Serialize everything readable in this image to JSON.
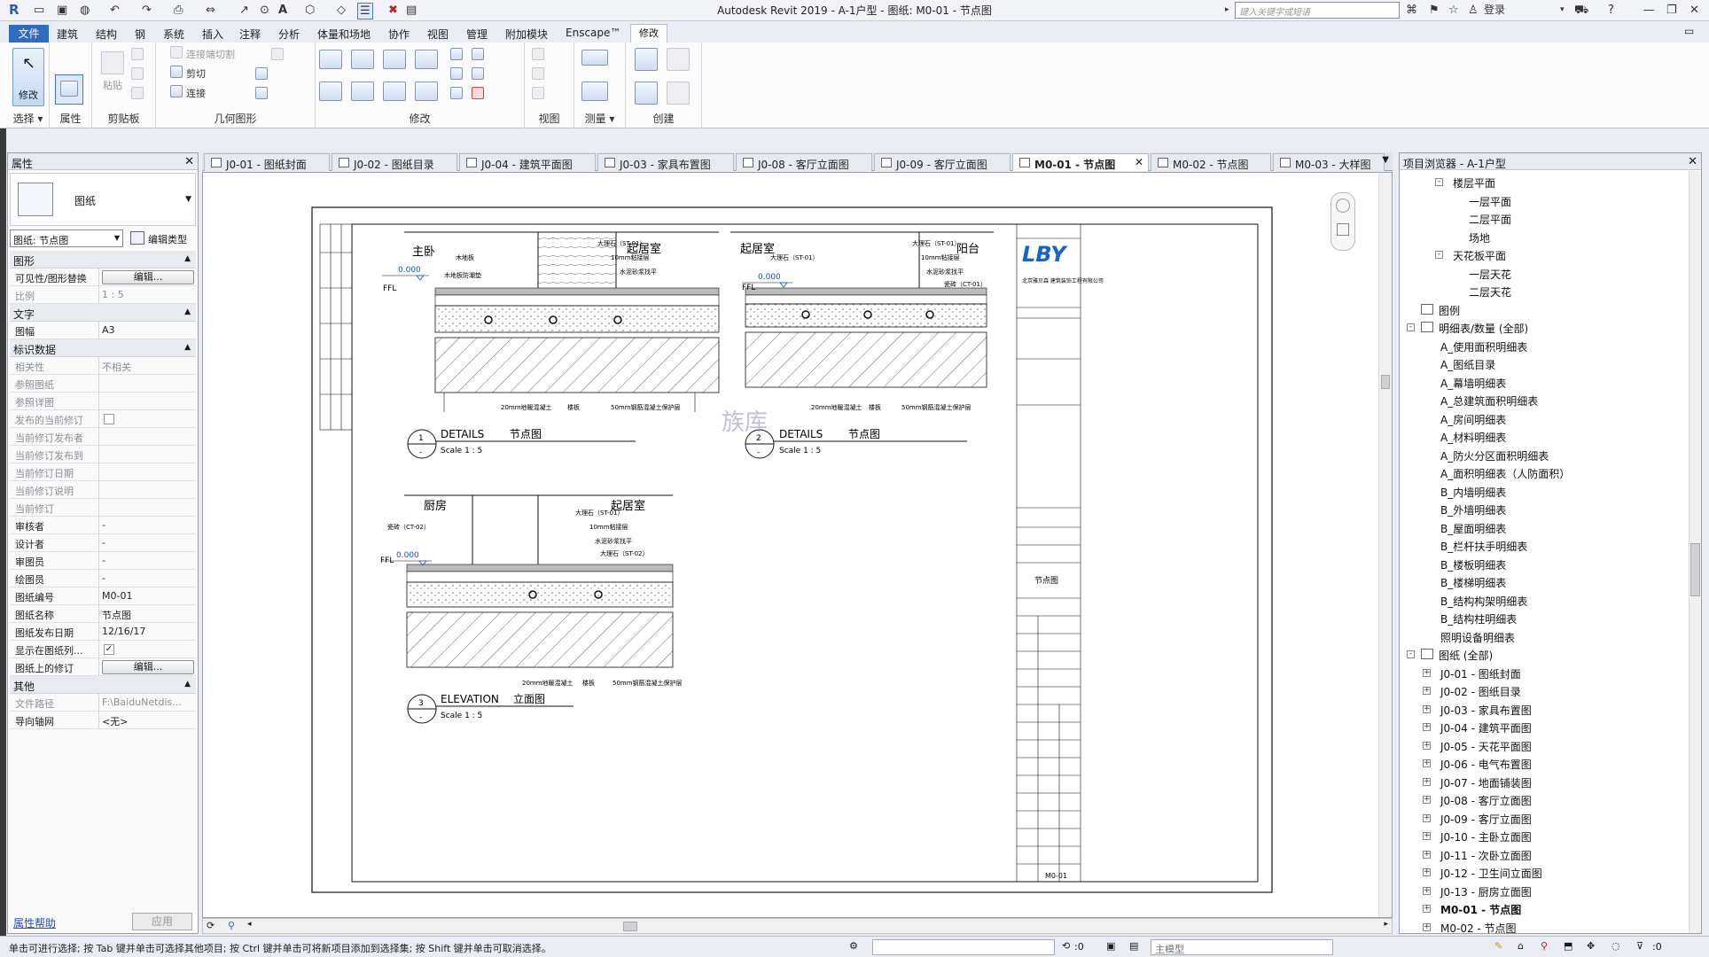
{
  "window": {
    "title": "Autodesk Revit 2019 -  A-1户型 - 图纸: M0-01 - 节点图",
    "search_placeholder": "键入关键字或短语",
    "login": "登录"
  },
  "ribbon_tabs": [
    "文件",
    "建筑",
    "结构",
    "钢",
    "系统",
    "插入",
    "注释",
    "分析",
    "体量和场地",
    "协作",
    "视图",
    "管理",
    "附加模块",
    "Enscape™",
    "修改"
  ],
  "ribbon_groups": {
    "select": "选择",
    "properties": "属性",
    "clipboard": "剪贴板",
    "geometry": "几何图形",
    "modify": "修改",
    "view": "视图",
    "measure": "测量",
    "create": "创建"
  },
  "ribbon_labels": {
    "modify_btn": "修改",
    "paste": "粘贴",
    "cut_join": "连接端切割",
    "cut": "剪切",
    "join": "连接"
  },
  "properties": {
    "title": "属性",
    "type_name": "图纸",
    "filter": "图纸: 节点图",
    "edit_type": "编辑类型",
    "sections": {
      "graphics": "图形",
      "text": "文字",
      "identity": "标识数据",
      "other": "其他"
    },
    "rows": {
      "vis_graphics": "可见性/图形替换",
      "vis_btn": "编辑...",
      "scale": "比例",
      "scale_val": "1 : 5",
      "sheet_size": "图幅",
      "sheet_size_val": "A3",
      "dependency": "相关性",
      "dependency_val": "不相关",
      "ref_sheet": "参照图纸",
      "ref_detail": "参照详图",
      "current_rev_issued": "发布的当前修订",
      "cur_rev_issued_by": "当前修订发布者",
      "cur_rev_issued_to": "当前修订发布到",
      "cur_rev_date": "当前修订日期",
      "cur_rev_desc": "当前修订说明",
      "cur_rev": "当前修订",
      "approved": "审核者",
      "approved_val": "-",
      "designed": "设计者",
      "designed_val": "-",
      "checked": "审图员",
      "checked_val": "-",
      "drawn": "绘图员",
      "drawn_val": "-",
      "sheet_no": "图纸编号",
      "sheet_no_val": "M0-01",
      "sheet_name": "图纸名称",
      "sheet_name_val": "节点图",
      "issue_date": "图纸发布日期",
      "issue_date_val": "12/16/17",
      "show_in_list": "显示在图纸列...",
      "revisions": "图纸上的修订",
      "rev_btn": "编辑...",
      "file_path": "文件路径",
      "file_path_val": "F:\\BaiduNetdis...",
      "guide_grid": "导向轴网",
      "guide_grid_val": "<无>"
    },
    "help": "属性帮助",
    "apply": "应用"
  },
  "view_tabs": [
    {
      "label": "J0-01 - 图纸封面"
    },
    {
      "label": "J0-02 - 图纸目录"
    },
    {
      "label": "J0-04 - 建筑平面图"
    },
    {
      "label": "J0-03 - 家具布置图"
    },
    {
      "label": "J0-08 - 客厅立面图"
    },
    {
      "label": "J0-09 - 客厅立面图"
    },
    {
      "label": "M0-01 - 节点图"
    },
    {
      "label": "M0-02 - 节点图"
    },
    {
      "label": "M0-03 - 大样图"
    }
  ],
  "drawing": {
    "rooms": {
      "d1_left": "主卧",
      "d1_right": "起居室",
      "d2_left": "起居室",
      "d2_right": "阳台",
      "d3_left": "厨房",
      "d3_right": "起居室"
    },
    "ffl": "FFL",
    "ffl_val": "0.000",
    "notes": {
      "wood_floor": "木地板",
      "wood_base": "木地板防潮垫",
      "marble": "大理石（ST-01）",
      "glue": "10mm粘接层",
      "mortar": "水泥砂浆找平",
      "screed": "20mm地暖混凝土",
      "slab": "楼板",
      "protect": "50mm钢筋混凝土保护层",
      "tile": "瓷砖（CT-01）",
      "tile2": "瓷砖（CT-02）",
      "marble2": "大理石（ST-02）"
    },
    "detail1": {
      "num": "1",
      "sub": "-",
      "title": "DETAILS",
      "cn": "节点图",
      "scale": "Scale    1 : 5"
    },
    "detail2": {
      "num": "2",
      "sub": "-",
      "title": "DETAILS",
      "cn": "节点图",
      "scale": "Scale    1 : 5"
    },
    "detail3": {
      "num": "3",
      "sub": "-",
      "title": "ELEVATION",
      "cn": "立面图",
      "scale": "Scale    1 : 5"
    },
    "watermark": "族库",
    "titleblock": {
      "logo": "LBY",
      "company": "北京雅贝森\n建筑装饰工程有限公司",
      "sheet_title": "节点图",
      "sheet_no": "M0-01"
    }
  },
  "browser": {
    "title": "项目浏览器 - A-1户型",
    "nodes": [
      {
        "label": "楼层平面",
        "lvl": 3,
        "exp": "-"
      },
      {
        "label": "一层平面",
        "lvl": 4
      },
      {
        "label": "二层平面",
        "lvl": 4
      },
      {
        "label": "场地",
        "lvl": 4
      },
      {
        "label": "天花板平面",
        "lvl": 3,
        "exp": "-"
      },
      {
        "label": "一层天花",
        "lvl": 4
      },
      {
        "label": "二层天花",
        "lvl": 4
      },
      {
        "label": "图例",
        "lvl": 1,
        "icon": true
      },
      {
        "label": "明细表/数量 (全部)",
        "lvl": 1,
        "exp": "-",
        "icon": true
      },
      {
        "label": "A_使用面积明细表",
        "lvl": 2
      },
      {
        "label": "A_图纸目录",
        "lvl": 2
      },
      {
        "label": "A_幕墙明细表",
        "lvl": 2
      },
      {
        "label": "A_总建筑面积明细表",
        "lvl": 2
      },
      {
        "label": "A_房间明细表",
        "lvl": 2
      },
      {
        "label": "A_材料明细表",
        "lvl": 2
      },
      {
        "label": "A_防火分区面积明细表",
        "lvl": 2
      },
      {
        "label": "A_面积明细表（人防面积）",
        "lvl": 2
      },
      {
        "label": "B_内墙明细表",
        "lvl": 2
      },
      {
        "label": "B_外墙明细表",
        "lvl": 2
      },
      {
        "label": "B_屋面明细表",
        "lvl": 2
      },
      {
        "label": "B_栏杆扶手明细表",
        "lvl": 2
      },
      {
        "label": "B_楼板明细表",
        "lvl": 2
      },
      {
        "label": "B_楼梯明细表",
        "lvl": 2
      },
      {
        "label": "B_结构构架明细表",
        "lvl": 2
      },
      {
        "label": "B_结构柱明细表",
        "lvl": 2
      },
      {
        "label": "照明设备明细表",
        "lvl": 2
      },
      {
        "label": "图纸 (全部)",
        "lvl": 1,
        "exp": "-",
        "icon": true
      },
      {
        "label": "J0-01 - 图纸封面",
        "lvl": 2,
        "exp": "+"
      },
      {
        "label": "J0-02 - 图纸目录",
        "lvl": 2,
        "exp": "+"
      },
      {
        "label": "J0-03 - 家具布置图",
        "lvl": 2,
        "exp": "+"
      },
      {
        "label": "J0-04 - 建筑平面图",
        "lvl": 2,
        "exp": "+"
      },
      {
        "label": "J0-05 - 天花平面图",
        "lvl": 2,
        "exp": "+"
      },
      {
        "label": "J0-06 - 电气布置图",
        "lvl": 2,
        "exp": "+"
      },
      {
        "label": "J0-07 - 地面铺装图",
        "lvl": 2,
        "exp": "+"
      },
      {
        "label": "J0-08 - 客厅立面图",
        "lvl": 2,
        "exp": "+"
      },
      {
        "label": "J0-09 - 客厅立面图",
        "lvl": 2,
        "exp": "+"
      },
      {
        "label": "J0-10 - 主卧立面图",
        "lvl": 2,
        "exp": "+"
      },
      {
        "label": "J0-11 - 次卧立面图",
        "lvl": 2,
        "exp": "+"
      },
      {
        "label": "J0-12 - 卫生间立面图",
        "lvl": 2,
        "exp": "+"
      },
      {
        "label": "J0-13 - 厨房立面图",
        "lvl": 2,
        "exp": "+"
      },
      {
        "label": "M0-01 - 节点图",
        "lvl": 2,
        "exp": "+",
        "bold": true
      },
      {
        "label": "M0-02 - 节点图",
        "lvl": 2,
        "exp": "+"
      },
      {
        "label": "M0-03 - 大样图",
        "lvl": 2,
        "exp": "+"
      }
    ]
  },
  "status": {
    "message": "单击可进行选择; 按 Tab 键并单击可选择其他项目; 按 Ctrl 键并单击可将新项目添加到选择集; 按 Shift 键并单击可取消选择。",
    "zero": ":0",
    "model": "主模型",
    "filter": ":0"
  }
}
